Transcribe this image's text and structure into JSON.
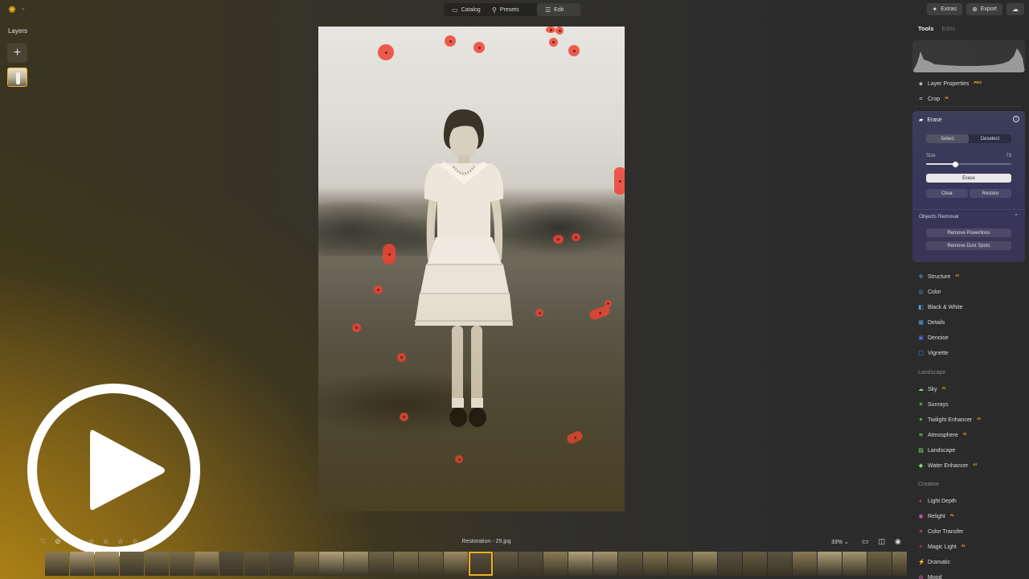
{
  "window": {
    "modes": [
      {
        "label": "Catalog",
        "icon": "folder-icon"
      },
      {
        "label": "Presets",
        "icon": "presets-icon"
      },
      {
        "label": "Edit",
        "icon": "sliders-icon",
        "active": true
      }
    ],
    "extras_label": "Extras",
    "export_label": "Export"
  },
  "layers": {
    "title": "Layers",
    "add_label": "+"
  },
  "canvas": {
    "filename": "Restoration - 29.jpg",
    "zoom": "33%",
    "rating_stars": 5
  },
  "panel": {
    "tabs": {
      "tools": "Tools",
      "edits": "Edits"
    },
    "top_tools": [
      {
        "label": "Layer Properties",
        "badge": "PRO",
        "icon": "layers-icon"
      },
      {
        "label": "Crop",
        "badge": "AI",
        "icon": "crop-icon"
      }
    ],
    "erase": {
      "title": "Erase",
      "select_label": "Select",
      "deselect_label": "Deselect",
      "size_label": "Size",
      "size_value": "73",
      "size_fraction": 0.34,
      "erase_label": "Erase",
      "clear_label": "Clear",
      "restore_label": "Restore",
      "objects_removal_label": "Objects Removal",
      "remove_powerlines_label": "Remove Powerlines",
      "remove_dust_spots_label": "Remove Dust Spots"
    },
    "essentials": [
      {
        "label": "Structure",
        "badge": "AI",
        "icon": "structure-icon",
        "color": "#4aa8f0"
      },
      {
        "label": "Color",
        "badge": "",
        "icon": "color-icon",
        "color": "#4aa8f0"
      },
      {
        "label": "Black & White",
        "badge": "",
        "icon": "bw-icon",
        "color": "#4aa8f0"
      },
      {
        "label": "Details",
        "badge": "",
        "icon": "details-icon",
        "color": "#4aa8f0"
      },
      {
        "label": "Denoise",
        "badge": "",
        "icon": "denoise-icon",
        "color": "#4a6ff0"
      },
      {
        "label": "Vignette",
        "badge": "",
        "icon": "vignette-icon",
        "color": "#4aa8f0"
      }
    ],
    "landscape_title": "Landscape",
    "landscape": [
      {
        "label": "Sky",
        "badge": "AI",
        "icon": "sky-icon",
        "color": "#7ee06a"
      },
      {
        "label": "Sunrays",
        "badge": "",
        "icon": "sunrays-icon",
        "color": "#7ee06a"
      },
      {
        "label": "Twilight Enhancer",
        "badge": "AI",
        "icon": "twilight-icon",
        "color": "#7ee06a"
      },
      {
        "label": "Atmosphere",
        "badge": "AI",
        "icon": "atmosphere-icon",
        "color": "#7ee06a"
      },
      {
        "label": "Landscape",
        "badge": "",
        "icon": "landscape-icon",
        "color": "#7ee06a"
      },
      {
        "label": "Water Enhancer",
        "badge": "AI",
        "icon": "water-icon",
        "color": "#7ee06a"
      }
    ],
    "creative_title": "Creative",
    "creative": [
      {
        "label": "Light Depth",
        "badge": "",
        "icon": "light-depth-icon",
        "color": "#e055b0"
      },
      {
        "label": "Relight",
        "badge": "AI",
        "icon": "relight-icon",
        "color": "#e055b0"
      },
      {
        "label": "Color Transfer",
        "badge": "",
        "icon": "color-transfer-icon",
        "color": "#e055b0"
      },
      {
        "label": "Magic Light",
        "badge": "AI",
        "icon": "magic-light-icon",
        "color": "#e055b0"
      },
      {
        "label": "Dramatic",
        "badge": "",
        "icon": "dramatic-icon",
        "color": "#e055b0"
      },
      {
        "label": "Mood",
        "badge": "",
        "icon": "mood-icon",
        "color": "#e055b0"
      }
    ]
  },
  "colors": {
    "accent": "#f0b020",
    "erase_marker": "#ee4234"
  }
}
